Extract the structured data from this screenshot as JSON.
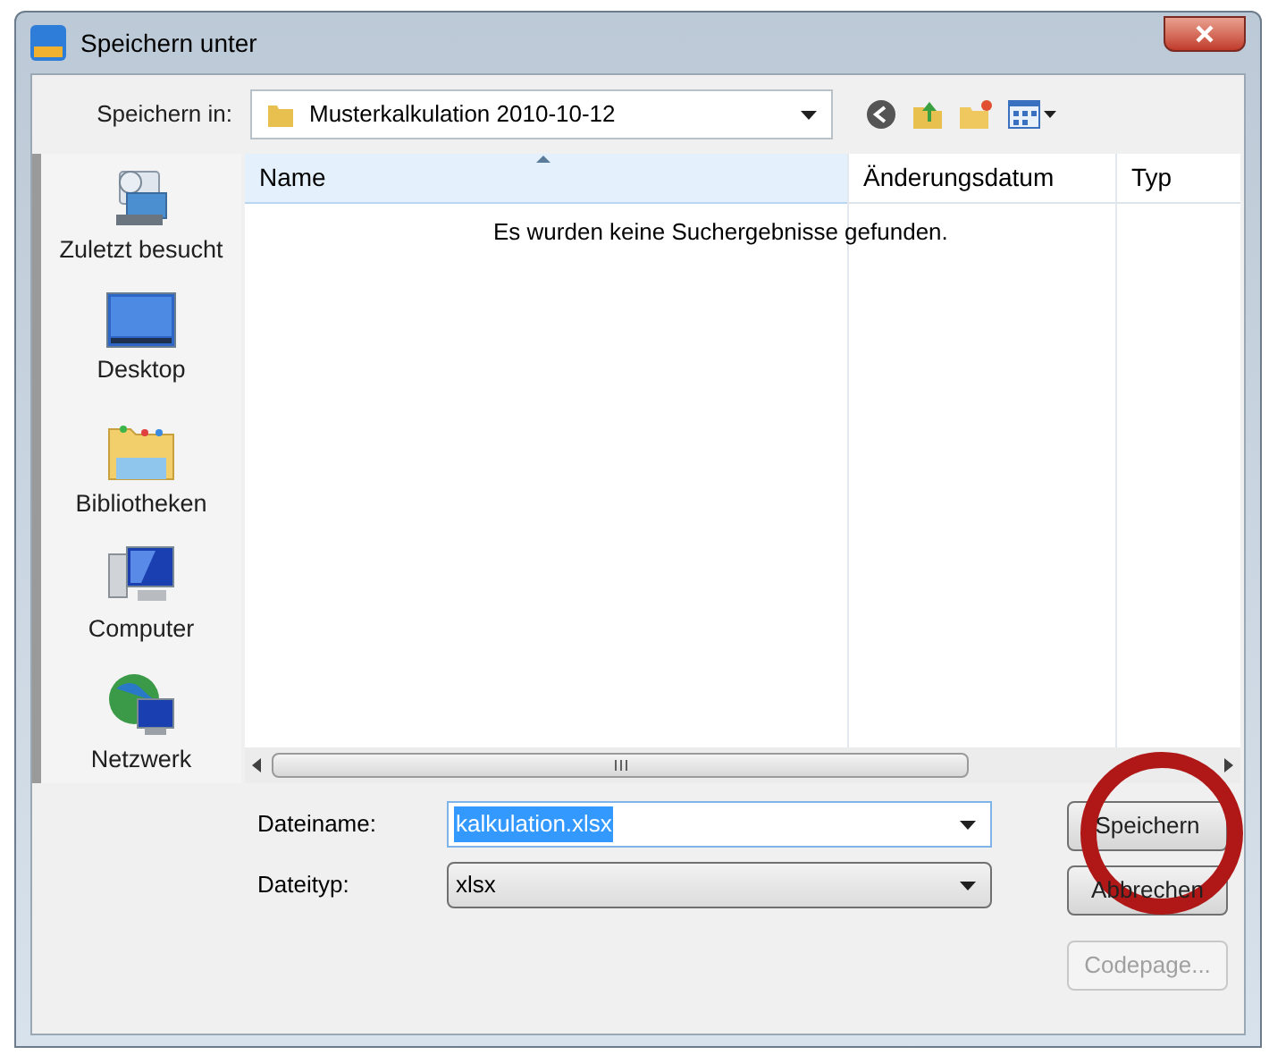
{
  "window": {
    "title": "Speichern unter"
  },
  "location": {
    "label": "Speichern in:",
    "value": "Musterkalkulation 2010-10-12"
  },
  "sidebar": {
    "items": [
      {
        "label": "Zuletzt besucht",
        "kind": "recent"
      },
      {
        "label": "Desktop",
        "kind": "desktop"
      },
      {
        "label": "Bibliotheken",
        "kind": "library"
      },
      {
        "label": "Computer",
        "kind": "computer"
      },
      {
        "label": "Netzwerk",
        "kind": "network"
      }
    ]
  },
  "table": {
    "columns": [
      "Name",
      "Änderungsdatum",
      "Typ"
    ],
    "empty_message": "Es wurden keine Suchergebnisse gefunden."
  },
  "filename": {
    "label": "Dateiname:",
    "value": "kalkulation.xlsx"
  },
  "filetype": {
    "label": "Dateityp:",
    "value": "xlsx"
  },
  "buttons": [
    {
      "label": "Speichern",
      "disabled": false
    },
    {
      "label": "Abbrechen",
      "disabled": false
    },
    {
      "label": "Codepage...",
      "disabled": true
    }
  ],
  "annotation": {
    "kind": "circle"
  }
}
